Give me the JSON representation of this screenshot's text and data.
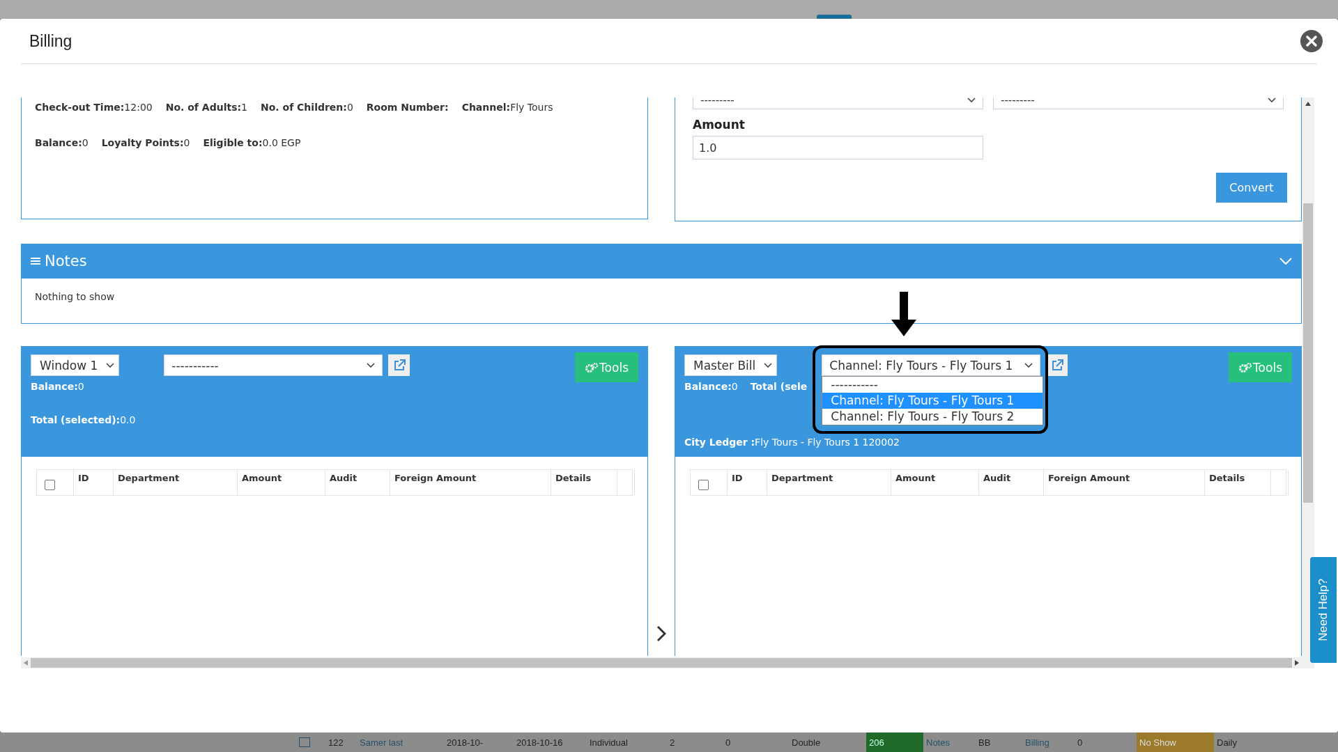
{
  "window": {
    "title": "Billing"
  },
  "guest_info": {
    "rows": [
      [
        {
          "label": "Check-out Time:",
          "value": "12:00"
        },
        {
          "label": "No. of Adults:",
          "value": "1"
        },
        {
          "label": "No. of Children:",
          "value": "0"
        },
        {
          "label": "Room Number:"
        },
        {
          "label": "Channel:",
          "value": "Fly Tours"
        }
      ],
      [
        {
          "label": "Balance:",
          "value": "0"
        },
        {
          "label": "Loyalty Points:",
          "value": "0"
        },
        {
          "label": "Eligible to:",
          "value": "0.0 EGP"
        }
      ]
    ]
  },
  "exchange": {
    "currency_from": "---------",
    "currency_to": "---------",
    "amount_label": "Amount",
    "amount": "1.0",
    "convert_button": "Convert"
  },
  "notes": {
    "title": "Notes",
    "expanded": true,
    "empty_text": "Nothing to show"
  },
  "bills": [
    {
      "window_select": "Window 1",
      "select_all_checked": false,
      "account_select": "-----------",
      "tools_button": "Tools",
      "info_rows": [
        [
          {
            "label": "Balance:",
            "value": "0"
          }
        ],
        [
          {
            "label": "Total (selected):",
            "value": "0.0"
          }
        ]
      ],
      "columns": [
        "ID",
        "Department",
        "Amount",
        "Audit",
        "Foreign Amount",
        "Details"
      ]
    },
    {
      "window_select": "Master Bill",
      "select_all_checked": false,
      "account_select": "Channel: Fly Tours - Fly Tours 1",
      "dropdown_open": true,
      "options": [
        {
          "label": "-----------",
          "selected": false
        },
        {
          "label": "Channel: Fly Tours - Fly Tours 1",
          "selected": true
        },
        {
          "label": "Channel: Fly Tours - Fly Tours 2",
          "selected": false
        }
      ],
      "tools_button": "Tools",
      "info_rows": [
        [
          {
            "label": "Balance:",
            "value": "0"
          },
          {
            "label": "Total (sele"
          }
        ],
        [
          {
            "label": "City Ledger :",
            "value": "Fly Tours - Fly Tours 1 120002"
          }
        ]
      ],
      "columns": [
        "ID",
        "Department",
        "Amount",
        "Audit",
        "Foreign Amount",
        "Details"
      ]
    }
  ],
  "help_tab": "Need Help?",
  "background_row_checked": false,
  "background_row": [
    {
      "text": "122",
      "kind": "text"
    },
    {
      "text": "Samer last",
      "kind": "link"
    },
    {
      "text": "2018-10-",
      "kind": "text"
    },
    {
      "text": "2018-10-16",
      "kind": "text"
    },
    {
      "text": "Individual",
      "kind": "text"
    },
    {
      "text": "2",
      "kind": "text"
    },
    {
      "text": "0",
      "kind": "text"
    },
    {
      "text": "Double",
      "kind": "text"
    },
    {
      "text": "206",
      "kind": "room"
    },
    {
      "text": "Notes",
      "kind": "link"
    },
    {
      "text": "BB",
      "kind": "text"
    },
    {
      "text": "Billing",
      "kind": "link"
    },
    {
      "text": "0",
      "kind": "text"
    },
    {
      "text": "No Show",
      "kind": "status"
    },
    {
      "text": "Daily",
      "kind": "text"
    }
  ]
}
